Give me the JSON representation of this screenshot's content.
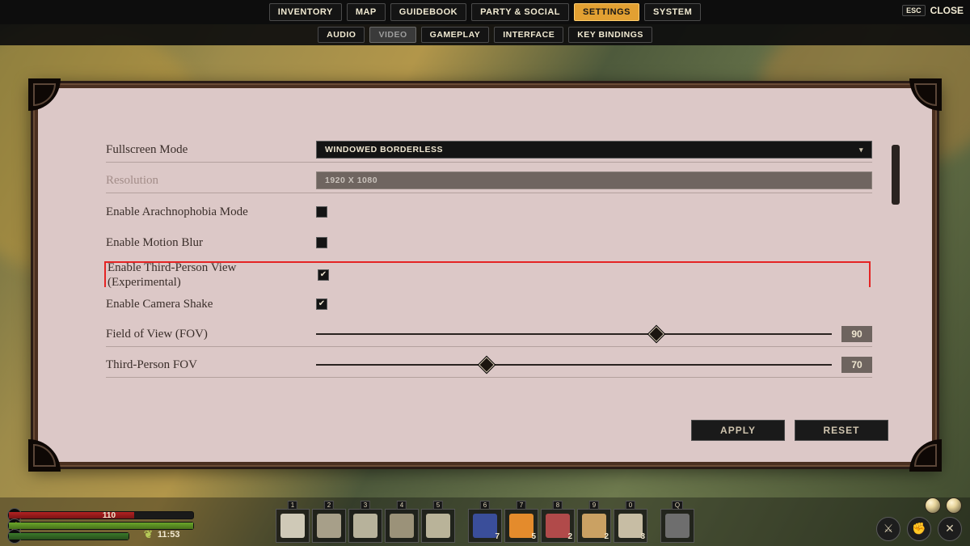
{
  "topbar": {
    "tabs": [
      "INVENTORY",
      "MAP",
      "GUIDEBOOK",
      "PARTY & SOCIAL",
      "SETTINGS",
      "SYSTEM"
    ],
    "activeIndex": 4,
    "close_key": "ESC",
    "close_label": "CLOSE"
  },
  "subbar": {
    "tabs": [
      "AUDIO",
      "VIDEO",
      "GAMEPLAY",
      "INTERFACE",
      "KEY BINDINGS"
    ],
    "activeIndex": 1
  },
  "settings": {
    "fullscreen": {
      "label": "Fullscreen Mode",
      "value": "WINDOWED BORDERLESS"
    },
    "resolution": {
      "label": "Resolution",
      "value": "1920 X 1080",
      "disabled": true
    },
    "arachnophobia": {
      "label": "Enable Arachnophobia Mode",
      "checked": false
    },
    "motion_blur": {
      "label": "Enable Motion Blur",
      "checked": false
    },
    "third_person": {
      "label": "Enable Third-Person View (Experimental)",
      "checked": true,
      "highlighted": true
    },
    "camera_shake": {
      "label": "Enable Camera Shake",
      "checked": true
    },
    "fov": {
      "label": "Field of View (FOV)",
      "value": 90,
      "min": 50,
      "max": 110,
      "percent": 66
    },
    "third_fov": {
      "label": "Third-Person FOV",
      "value": 70,
      "min": 50,
      "max": 110,
      "percent": 33
    }
  },
  "buttons": {
    "apply": "APPLY",
    "reset": "RESET"
  },
  "hud": {
    "hp": 110,
    "clock": "11:53",
    "hotbar_keys": [
      "1",
      "2",
      "3",
      "4",
      "5",
      "",
      "6",
      "7",
      "8",
      "9",
      "0",
      "",
      "Q"
    ],
    "hotbar_counts": [
      "",
      "",
      "",
      "",
      "",
      "",
      "7",
      "5",
      "2",
      "2",
      "3",
      "",
      ""
    ],
    "item_colors": [
      "#cfc9b7",
      "#a79f89",
      "#b7b29b",
      "#9b9279",
      "#b9b399",
      "",
      "#3a4e9a",
      "#e48b2c",
      "#b14a4a",
      "#caa163",
      "#c7bda4",
      "",
      "#6e6e6e"
    ]
  }
}
